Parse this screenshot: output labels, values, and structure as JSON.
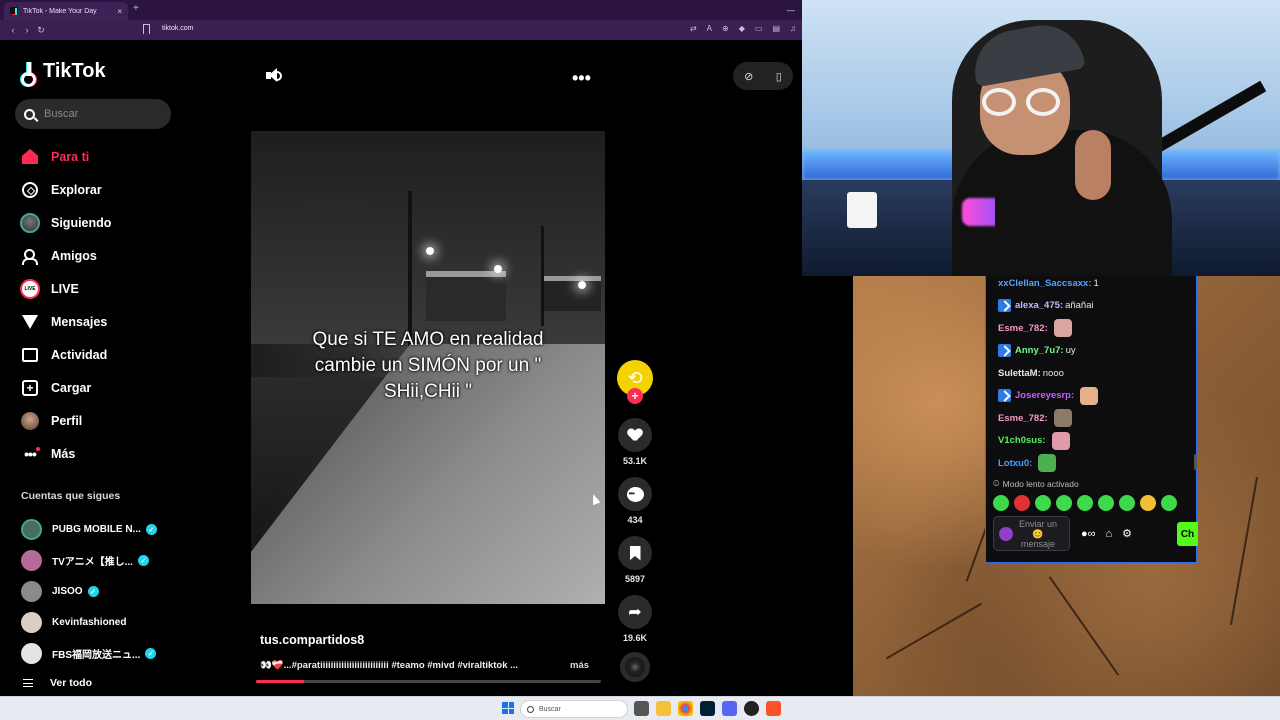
{
  "browser": {
    "tab_title": "TikTok - Make Your Day",
    "tab_close": "×",
    "new_tab": "+",
    "url": "tiktok.com",
    "window_controls": [
      "—",
      "☐",
      "✕"
    ]
  },
  "tiktok": {
    "logo": "TikTok",
    "search_placeholder": "Buscar",
    "menu": [
      {
        "label": "Para ti",
        "icon": "home-icon",
        "active": true
      },
      {
        "label": "Explorar",
        "icon": "compass-icon"
      },
      {
        "label": "Siguiendo",
        "icon": "following-avatar-icon"
      },
      {
        "label": "Amigos",
        "icon": "friends-icon"
      },
      {
        "label": "LIVE",
        "icon": "live-icon"
      },
      {
        "label": "Mensajes",
        "icon": "send-icon"
      },
      {
        "label": "Actividad",
        "icon": "activity-icon"
      },
      {
        "label": "Cargar",
        "icon": "upload-icon"
      },
      {
        "label": "Perfil",
        "icon": "profile-avatar-icon"
      },
      {
        "label": "Más",
        "icon": "more-dots-icon"
      }
    ],
    "live_icon_text": "LIVE",
    "following_title": "Cuentas que sigues",
    "following": [
      {
        "name": "PUBG MOBILE N...",
        "verified": true,
        "color": "#4d6b5a"
      },
      {
        "name": "TVアニメ【推し...",
        "verified": true,
        "color": "#b56a9a"
      },
      {
        "name": "JISOO",
        "verified": true,
        "color": "#8a8a8a"
      },
      {
        "name": "Kevinfashioned",
        "verified": false,
        "color": "#d8d0c8"
      },
      {
        "name": "FBS福岡放送ニュ...",
        "verified": true,
        "color": "#e4e4e4"
      }
    ],
    "see_all": "Ver todo",
    "video_caption": "Que si TE AMO en realidad cambie un SIMÓN por un \" SHii,CHii \"",
    "author": "tus.compartidos8",
    "description": "👀❤️‍🩹...#paratiiiiiiiiiiiiiiiiiiiiiiiiii #teamo #mivd #viraltiktok ...",
    "more": "más",
    "progress": 0.14,
    "actions": {
      "likes": "53.1K",
      "comments": "434",
      "saves": "5897",
      "shares": "19.6K"
    }
  },
  "chat": {
    "messages": [
      {
        "user": "xxClellan_Saccsaxx:",
        "text": "1",
        "color": "#53a4ff",
        "badge": false,
        "emote": null
      },
      {
        "user": "alexa_475:",
        "text": "añañai",
        "color": "#c9b8ff",
        "badge": true,
        "emote": null
      },
      {
        "user": "Esme_782:",
        "text": "",
        "color": "#f59ac0",
        "badge": false,
        "emote": "#d9a7a0"
      },
      {
        "user": "Anny_7u7:",
        "text": "uy",
        "color": "#7cf58a",
        "badge": true,
        "emote": null
      },
      {
        "user": "SulettaM:",
        "text": "nooo",
        "color": "#e6e6e6",
        "badge": false,
        "emote": null
      },
      {
        "user": "Josereyesrp:",
        "text": "",
        "color": "#c85bff",
        "badge": true,
        "emote": "#e8b08a"
      },
      {
        "user": "Esme_782:",
        "text": "",
        "color": "#f59ac0",
        "badge": false,
        "emote": "#8a7a66"
      },
      {
        "user": "V1ch0sus:",
        "text": "",
        "color": "#56f05c",
        "badge": false,
        "emote": "#e09aa8"
      },
      {
        "user": "Lotxu0:",
        "text": "",
        "color": "#4c9dff",
        "badge": false,
        "emote": "#4caf50"
      }
    ],
    "slow_mode": "Modo lento activado",
    "input_placeholder": "Enviar un 😊 mensaje",
    "send_label": "Ch"
  },
  "taskbar": {
    "search_placeholder": "Buscar"
  }
}
